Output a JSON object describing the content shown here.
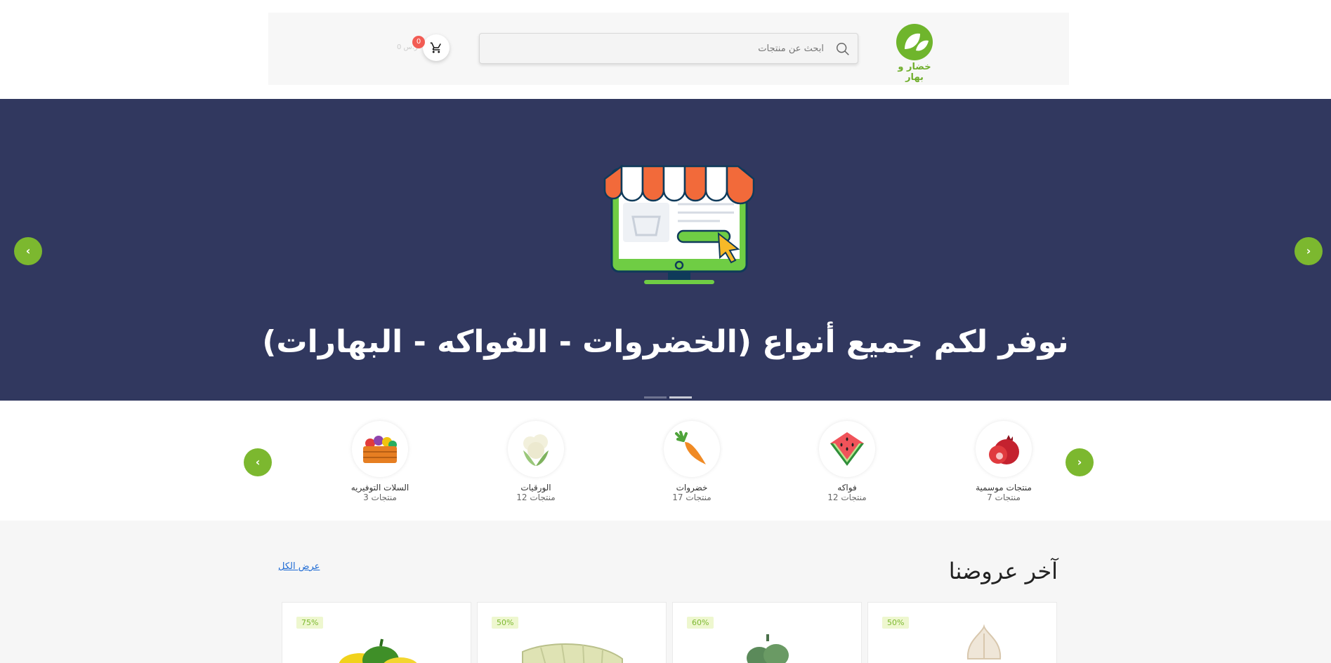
{
  "header": {
    "logo_text": "خضار و بهار",
    "search_placeholder": "ابحث عن منتجات",
    "cart_count": "0",
    "cart_amount": "0 ر.س"
  },
  "hero": {
    "title": "نوفر لكم جميع أنواع (الخضروات - الفواكه - البهارات)",
    "prev_label": "‹",
    "next_label": "›",
    "slides": 2,
    "active_slide": 2
  },
  "categories": {
    "prev_label": "‹",
    "next_label": "›",
    "items": [
      {
        "name": "منتجات موسمية",
        "count": "منتجات 7",
        "icon": "pomegranate-icon"
      },
      {
        "name": "فواكه",
        "count": "منتجات 12",
        "icon": "watermelon-icon"
      },
      {
        "name": "خضروات",
        "count": "منتجات 17",
        "icon": "carrot-icon"
      },
      {
        "name": "الورقيات",
        "count": "منتجات 12",
        "icon": "cauliflower-icon"
      },
      {
        "name": "السلات التوفيريه",
        "count": "منتجات 3",
        "icon": "basket-icon"
      }
    ]
  },
  "offers": {
    "title": "آخر عروضنا",
    "view_all": "عرض الكل",
    "products": [
      {
        "discount": "50%",
        "icon": "garlic-icon"
      },
      {
        "discount": "60%",
        "icon": "artichoke-icon"
      },
      {
        "discount": "50%",
        "icon": "corn-icon"
      },
      {
        "discount": "75%",
        "icon": "pepper-icon"
      }
    ]
  },
  "colors": {
    "accent_green": "#7cb82f",
    "hero_bg": "#31385f",
    "badge_red": "#f25c54",
    "link_blue": "#1d6ad4"
  }
}
